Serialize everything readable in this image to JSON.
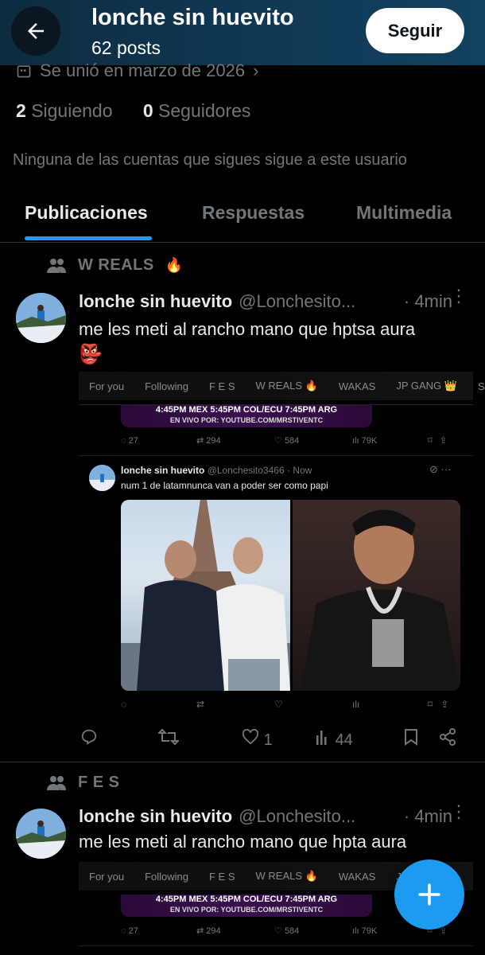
{
  "header": {
    "title": "lonche sin huevito",
    "posts_count": "62 posts",
    "follow_label": "Seguir"
  },
  "profile": {
    "joined": "Se unió en marzo de 2026",
    "following_count": "2",
    "following_label": "Siguiendo",
    "followers_count": "0",
    "followers_label": "Seguidores",
    "no_followers_note": "Ninguna de las cuentas que sigues sigue a este usuario"
  },
  "tabs": [
    {
      "label": "Publicaciones"
    },
    {
      "label": "Respuestas"
    },
    {
      "label": "Multimedia"
    }
  ],
  "posts": [
    {
      "community": "W REALS",
      "community_emoji": "🔥",
      "name": "lonche sin huevito",
      "handle": "@Lonchesito...",
      "time": "· 4min",
      "text": "me les meti al rancho mano que hptsa aura",
      "text_emoji": "👺",
      "embed": {
        "chips": [
          "For you",
          "Following",
          "F E S",
          "W REALS 🔥",
          "WAKAS",
          "JP GANG 👑",
          "S"
        ],
        "banner_line1": "4:45PM MEX  5:45PM COL/ECU  7:45PM ARG",
        "banner_line2": "EN VIVO POR: YOUTUBE.COM/MRSTIVENTC",
        "stats": {
          "replies": "27",
          "reposts": "294",
          "likes": "584",
          "views": "79K"
        },
        "quote": {
          "name": "lonche sin huevito",
          "handle": "@Lonchesito3466 · Now",
          "text": "num 1 de latamnunca van a poder ser como papi"
        }
      },
      "actions": {
        "likes": "1",
        "views": "44"
      }
    },
    {
      "community": "F E S",
      "name": "lonche sin huevito",
      "handle": "@Lonchesito...",
      "time": "· 4min",
      "text": "me les meti al rancho mano que hpta aura",
      "embed": {
        "chips": [
          "For you",
          "Following",
          "F E S",
          "W REALS 🔥",
          "WAKAS",
          "JP"
        ],
        "banner_line1": "4:45PM MEX  5:45PM COL/ECU  7:45PM ARG",
        "banner_line2": "EN VIVO POR: YOUTUBE.COM/MRSTIVENTC",
        "stats": {
          "replies": "27",
          "reposts": "294",
          "likes": "584",
          "views": "79K"
        }
      }
    }
  ],
  "colors": {
    "accent": "#1d9bf0",
    "muted": "#71767b",
    "text": "#e7e9ea",
    "background": "#000000"
  }
}
